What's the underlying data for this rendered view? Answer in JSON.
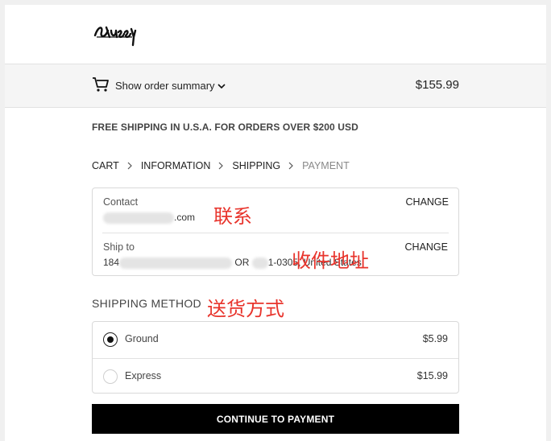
{
  "header": {
    "logo_alt": "Stüssy"
  },
  "summary": {
    "toggle_label": "Show order summary",
    "total": "$155.99"
  },
  "promo": "FREE SHIPPING IN U.S.A. FOR ORDERS OVER $200 USD",
  "breadcrumbs": [
    "CART",
    "INFORMATION",
    "SHIPPING",
    "PAYMENT"
  ],
  "review": {
    "contact": {
      "label": "Contact",
      "value_suffix": ".com",
      "change": "CHANGE",
      "annotation": "联系"
    },
    "ship_to": {
      "label": "Ship to",
      "value_prefix": "184",
      "value_mid": "OR",
      "value_end": "1-0305, United States",
      "change": "CHANGE",
      "annotation": "收件地址"
    }
  },
  "shipping": {
    "title": "SHIPPING METHOD",
    "annotation": "送货方式",
    "methods": [
      {
        "name": "Ground",
        "price": "$5.99",
        "selected": true
      },
      {
        "name": "Express",
        "price": "$15.99",
        "selected": false
      }
    ]
  },
  "continue_label": "CONTINUE TO PAYMENT"
}
